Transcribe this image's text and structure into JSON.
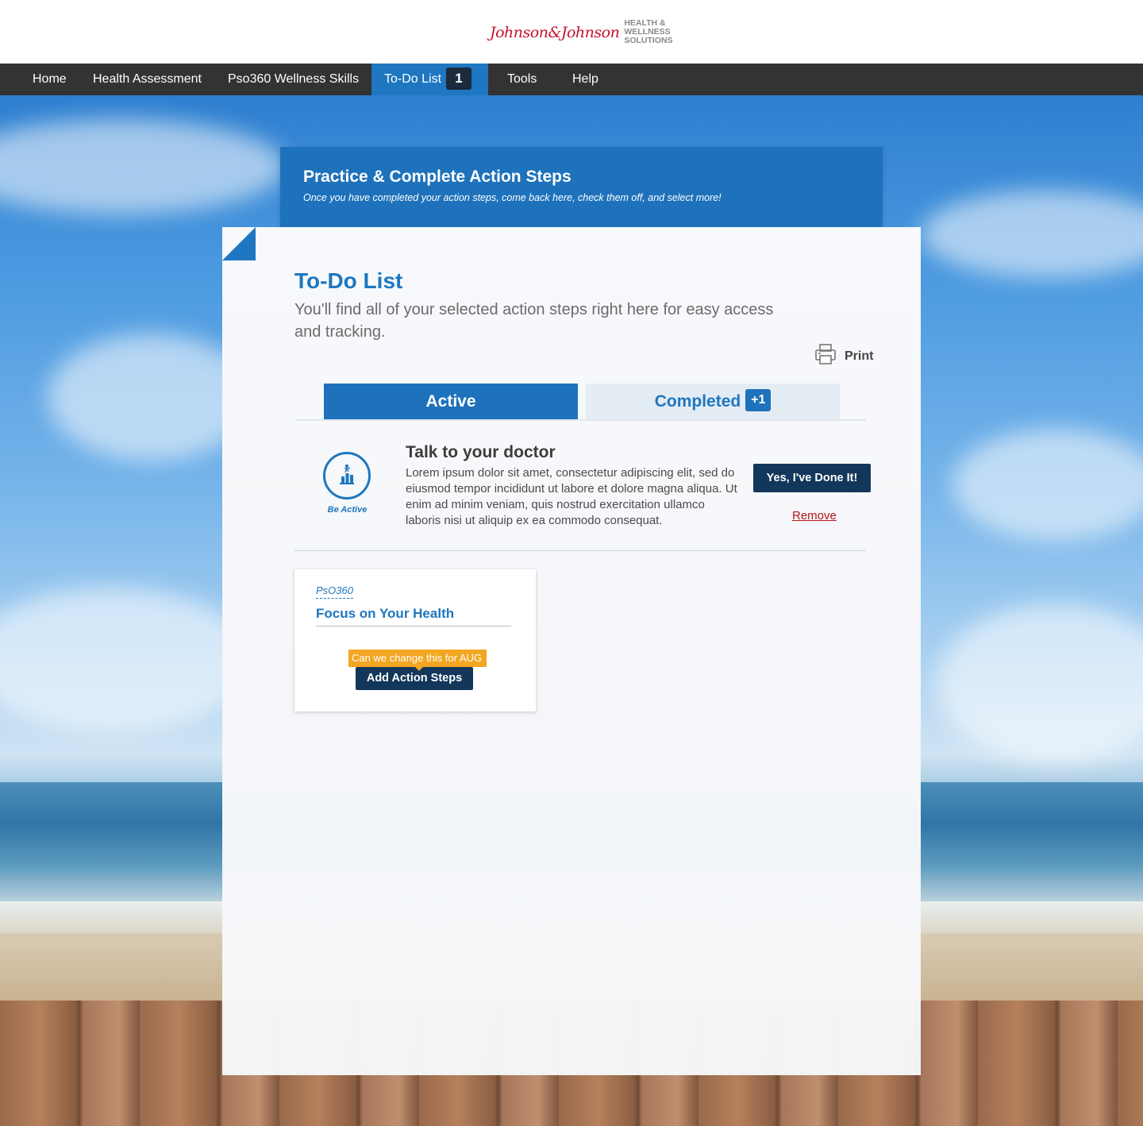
{
  "brand": {
    "script": "Johnson&Johnson",
    "line1": "HEALTH &",
    "line2": "WELLNESS",
    "line3": "SOLUTIONS"
  },
  "nav": {
    "items": [
      {
        "label": "Home"
      },
      {
        "label": "Health Assessment"
      },
      {
        "label": "Pso360 Wellness Skills"
      },
      {
        "label": "To-Do List",
        "badge": "1",
        "active": true
      },
      {
        "label": "Tools"
      },
      {
        "label": "Help"
      }
    ]
  },
  "banner": {
    "title": "Practice & Complete Action Steps",
    "subtitle": "Once you have completed your action steps, come back here, check them off, and select more!"
  },
  "todo": {
    "title": "To-Do List",
    "description": "You'll find all of your selected action steps right here for easy access and tracking.",
    "print_label": "Print"
  },
  "tabs": {
    "active_label": "Active",
    "completed_label": "Completed",
    "completed_badge": "+1"
  },
  "action_item": {
    "icon_label": "Be Active",
    "title": "Talk to your doctor",
    "description": "Lorem ipsum dolor sit amet, consectetur adipiscing elit, sed do eiusmod tempor incididunt ut labore et dolore magna aliqua. Ut enim ad minim veniam, quis nostrud exercitation ullamco laboris nisi ut aliquip ex ea commodo consequat.",
    "done_label": "Yes, I've Done It!",
    "remove_label": "Remove"
  },
  "skill_card": {
    "category": "PsO360",
    "title": "Focus on Your Health",
    "tooltip": "Can we change this for AUG",
    "button_label": "Add Action Steps"
  },
  "colors": {
    "primary_blue": "#1e77c0",
    "dark_navy": "#13375a",
    "nav_bg": "#333333",
    "remove_red": "#b8141b",
    "tooltip_orange": "#f3a622"
  }
}
